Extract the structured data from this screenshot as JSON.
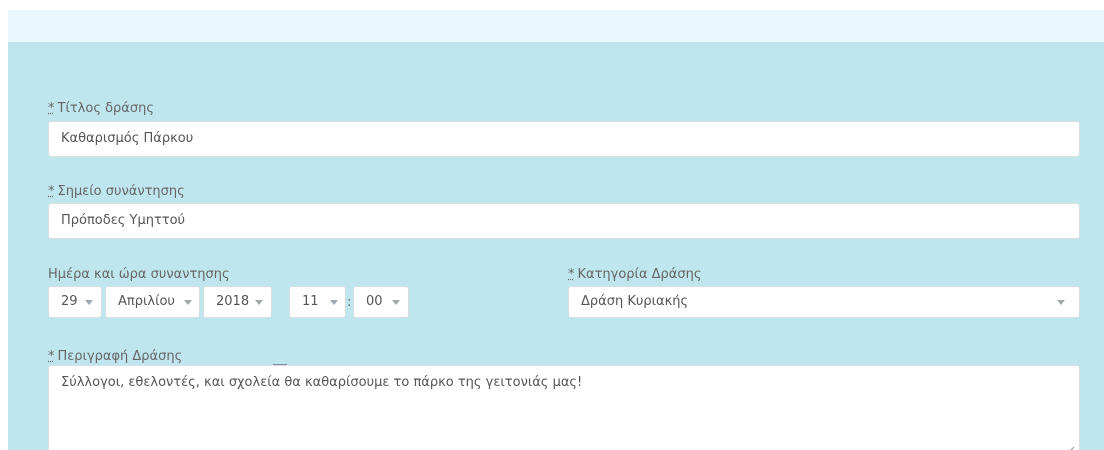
{
  "form": {
    "title_label": "Τίτλος δράσης",
    "title_value": "Καθαρισμός Πάρκου",
    "meeting_point_label": "Σημείο συνάντησης",
    "meeting_point_value": "Πρόποδες Υμηττού",
    "datetime_label": "Ημέρα και ώρα συναντησης",
    "date": {
      "day": "29",
      "month": "Απριλίου",
      "year": "2018",
      "hour": "11",
      "minute": "00"
    },
    "category_label": "Κατηγορία Δράσης",
    "category_value": "Δράση Κυριακής",
    "description_label": "Περιγραφή Δράσης",
    "description_value": "Σύλλογοι, εθελοντές, και σχολεία θα καθαρίσουμε το πάρκο της γειτονιάς μας!"
  },
  "ui": {
    "required_mark": "*"
  },
  "icons": {
    "caret": "chevron-down-icon",
    "resize": "resize-icon"
  },
  "colors": {
    "background": "#bfe6ee",
    "strip": "#eaf7fb",
    "border": "#d8dde2",
    "text": "#555555"
  }
}
